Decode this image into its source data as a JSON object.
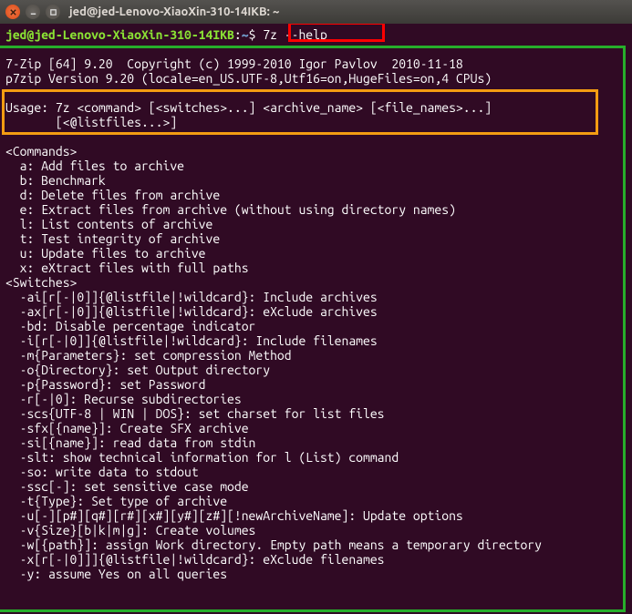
{
  "titlebar": {
    "title": "jed@jed-Lenovo-XiaoXin-310-14IKB: ~"
  },
  "prompt": {
    "user_host": "jed@jed-Lenovo-XiaoXin-310-14IKB",
    "colon": ":",
    "path": "~",
    "sigil": "$",
    "command": "7z --help"
  },
  "output": {
    "blank0": "",
    "header1": "7-Zip [64] 9.20  Copyright (c) 1999-2010 Igor Pavlov  2010-11-18",
    "header2": "p7zip Version 9.20 (locale=en_US.UTF-8,Utf16=on,HugeFiles=on,4 CPUs)",
    "blank1": "",
    "usage1": "Usage: 7z <command> [<switches>...] <archive_name> [<file_names>...]",
    "usage2": "       [<@listfiles...>]",
    "blank2": "",
    "commands_hdr": "<Commands>",
    "cmd_a": "  a: Add files to archive",
    "cmd_b": "  b: Benchmark",
    "cmd_d": "  d: Delete files from archive",
    "cmd_e": "  e: Extract files from archive (without using directory names)",
    "cmd_l": "  l: List contents of archive",
    "cmd_t": "  t: Test integrity of archive",
    "cmd_u": "  u: Update files to archive",
    "cmd_x": "  x: eXtract files with full paths",
    "switches_hdr": "<Switches>",
    "sw_ai": "  -ai[r[-|0]]{@listfile|!wildcard}: Include archives",
    "sw_ax": "  -ax[r[-|0]]{@listfile|!wildcard}: eXclude archives",
    "sw_bd": "  -bd: Disable percentage indicator",
    "sw_i": "  -i[r[-|0]]{@listfile|!wildcard}: Include filenames",
    "sw_m": "  -m{Parameters}: set compression Method",
    "sw_o": "  -o{Directory}: set Output directory",
    "sw_p": "  -p{Password}: set Password",
    "sw_r": "  -r[-|0]: Recurse subdirectories",
    "sw_scs": "  -scs{UTF-8 | WIN | DOS}: set charset for list files",
    "sw_sfx": "  -sfx[{name}]: Create SFX archive",
    "sw_si": "  -si[{name}]: read data from stdin",
    "sw_slt": "  -slt: show technical information for l (List) command",
    "sw_so": "  -so: write data to stdout",
    "sw_ssc": "  -ssc[-]: set sensitive case mode",
    "sw_t": "  -t{Type}: Set type of archive",
    "sw_u": "  -u[-][p#][q#][r#][x#][y#][z#][!newArchiveName]: Update options",
    "sw_v": "  -v{Size}[b|k|m|g]: Create volumes",
    "sw_w": "  -w[{path}]: assign Work directory. Empty path means a temporary directory",
    "sw_x": "  -x[r[-|0]]]{@listfile|!wildcard}: eXclude filenames",
    "sw_y": "  -y: assume Yes on all queries"
  }
}
